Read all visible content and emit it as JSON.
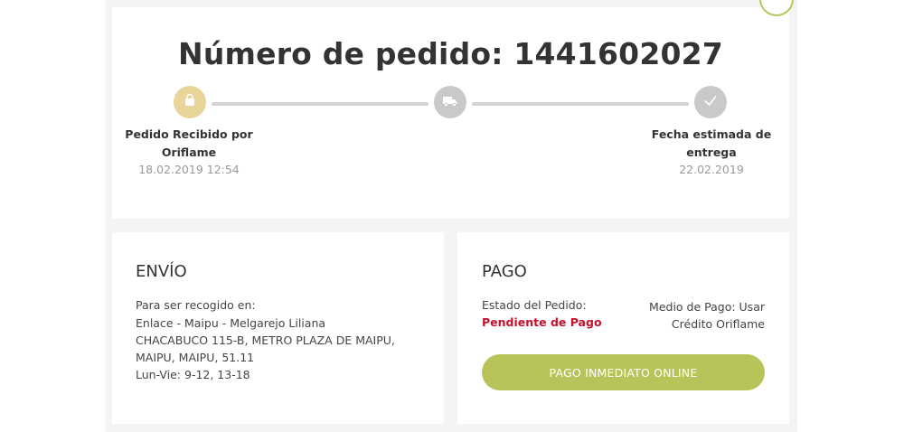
{
  "order": {
    "title": "Número de pedido: 1441602027",
    "steps": [
      {
        "label_line1": "Pedido Recibido por",
        "label_line2": "Oriflame",
        "date": "18.02.2019 12:54",
        "status": "done",
        "icon": "shopping-bag-icon"
      },
      {
        "label_line1": "",
        "label_line2": "",
        "date": "",
        "status": "pending",
        "icon": "truck-icon"
      },
      {
        "label_line1": "Fecha estimada de",
        "label_line2": "entrega",
        "date": "22.02.2019",
        "status": "pending",
        "icon": "check-icon"
      }
    ]
  },
  "shipping": {
    "title": "ENVÍO",
    "lines": [
      "Para ser recogido en:",
      "Enlace - Maipu - Melgarejo Liliana",
      "CHACABUCO 115-B, METRO PLAZA DE MAIPU,",
      "MAIPU, MAIPU, 51.11",
      "Lun-Vie: 9-12, 13-18"
    ]
  },
  "payment": {
    "title": "PAGO",
    "status_label": "Estado del Pedido:",
    "status_value": "Pendiente de Pago",
    "method_line1": "Medio de Pago: Usar",
    "method_line2": "Crédito Oriflame",
    "button_label": "PAGO INMEDIATO ONLINE"
  },
  "colors": {
    "accent": "#b8c45a",
    "step_done": "#e8d59a",
    "step_pending": "#c9c9c9",
    "status_pending": "#c8102e"
  }
}
